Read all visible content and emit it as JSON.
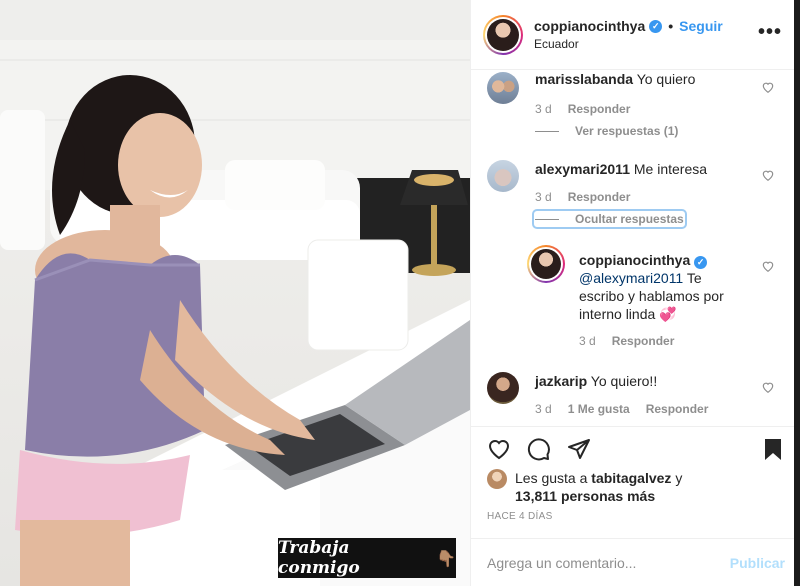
{
  "photo": {
    "caption": "Trabaja conmigo",
    "caption_emoji": "👇🏽"
  },
  "header": {
    "username": "coppianocinthya",
    "verified_icon": "verified-badge-icon",
    "separator": "•",
    "follow_label": "Seguir",
    "location": "Ecuador",
    "more_icon": "more-options-icon",
    "more_glyph": "•••"
  },
  "comments": [
    {
      "username": "marisslabanda",
      "text": "Yo quiero",
      "time": "3 d",
      "reply_label": "Responder",
      "replies_toggle": "Ver respuestas (1)"
    },
    {
      "username": "alexymari2011",
      "text": "Me interesa",
      "time": "3 d",
      "reply_label": "Responder",
      "replies_toggle": "Ocultar respuestas",
      "reply": {
        "username": "coppianocinthya",
        "mention": "@alexymari2011",
        "text": "Te escribo y hablamos por interno linda",
        "emoji": "💞",
        "time": "3 d",
        "reply_label": "Responder"
      }
    },
    {
      "username": "jazkarip",
      "text": "Yo quiero!!",
      "time": "3 d",
      "likes_label": "1 Me gusta",
      "reply_label": "Responder"
    }
  ],
  "actions": {
    "like_icon": "heart-icon",
    "comment_icon": "comment-icon",
    "share_icon": "share-icon",
    "save_icon": "bookmark-icon"
  },
  "likes": {
    "prefix": "Les gusta a",
    "user": "tabitagalvez",
    "connector": "y",
    "count": "13,811",
    "suffix": "personas más"
  },
  "posted": "HACE 4 DÍAS",
  "add_comment": {
    "placeholder": "Agrega un comentario...",
    "post_label": "Publicar"
  }
}
